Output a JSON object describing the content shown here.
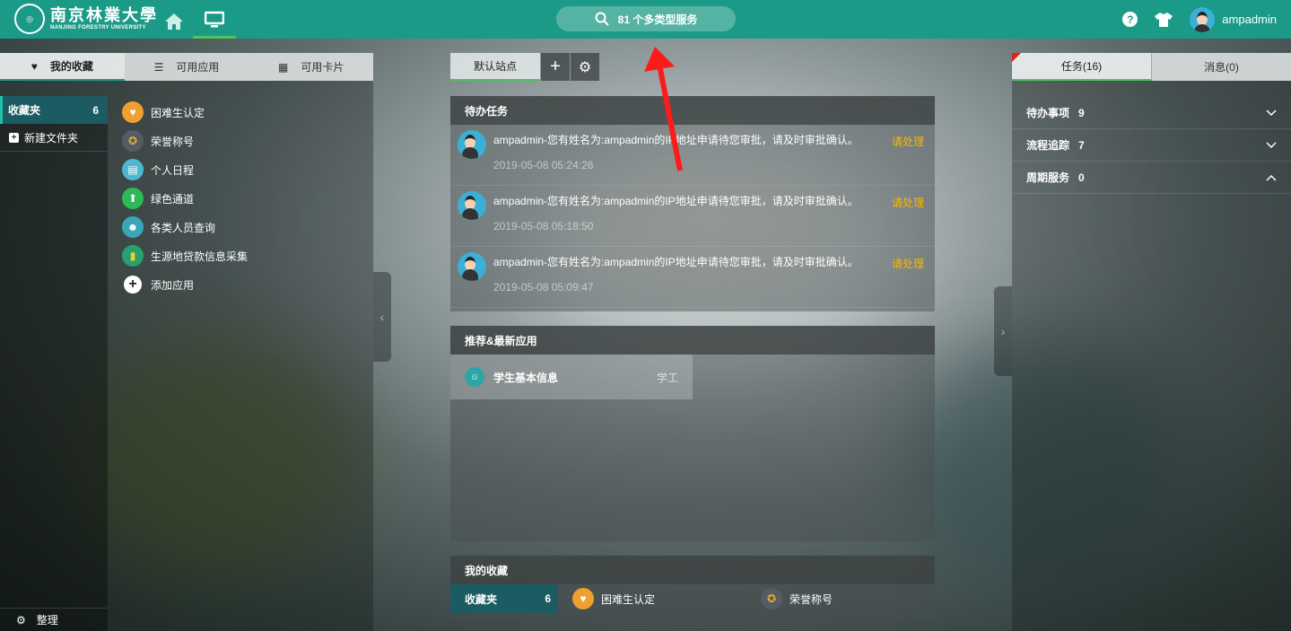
{
  "header": {
    "logo_cn": "南京林業大學",
    "logo_en": "NANJING FORESTRY UNIVERSITY",
    "search_text": "81 个多类型服务",
    "username": "ampadmin",
    "help_glyph": "?"
  },
  "left": {
    "tabs": [
      {
        "label": "我的收藏",
        "icon": "heart-icon"
      },
      {
        "label": "可用应用",
        "icon": "list-icon"
      },
      {
        "label": "可用卡片",
        "icon": "grid-icon"
      }
    ],
    "folder": {
      "label": "收藏夹",
      "count": "6"
    },
    "new_folder": "新建文件夹",
    "footer": "整理",
    "apps": [
      {
        "label": "困难生认定",
        "color": "#f0a030"
      },
      {
        "label": "荣誉称号",
        "color": "#555c66"
      },
      {
        "label": "个人日程",
        "color": "#4fb8d0"
      },
      {
        "label": "绿色通道",
        "color": "#2fb85a"
      },
      {
        "label": "各类人员查询",
        "color": "#3aa6b8"
      },
      {
        "label": "生源地贷款信息采集",
        "color": "#28a070"
      }
    ],
    "add_app": "添加应用"
  },
  "center": {
    "site_tab": "默认站点",
    "todo_title": "待办任务",
    "tasks": [
      {
        "text": "ampadmin-您有姓名为:ampadmin的IP地址申请待您审批，请及时审批确认。",
        "time": "2019-05-08 05:24:26",
        "action": "请处理"
      },
      {
        "text": "ampadmin-您有姓名为:ampadmin的IP地址申请待您审批，请及时审批确认。",
        "time": "2019-05-08 05:18:50",
        "action": "请处理"
      },
      {
        "text": "ampadmin-您有姓名为:ampadmin的IP地址申请待您审批，请及时审批确认。",
        "time": "2019-05-08 05:09:47",
        "action": "请处理"
      }
    ],
    "rec_title": "推荐&最新应用",
    "rec_apps": [
      {
        "label": "学生基本信息",
        "tag": "学工"
      }
    ],
    "fav_title": "我的收藏",
    "fav_folder": {
      "label": "收藏夹",
      "count": "6"
    },
    "fav_apps": [
      {
        "label": "困难生认定"
      },
      {
        "label": "荣誉称号"
      }
    ]
  },
  "right": {
    "tabs": [
      {
        "label": "任务(16)"
      },
      {
        "label": "消息(0)"
      }
    ],
    "items": [
      {
        "label": "待办事项",
        "count": "9",
        "chevron": "down"
      },
      {
        "label": "流程追踪",
        "count": "7",
        "chevron": "down"
      },
      {
        "label": "周期服务",
        "count": "0",
        "chevron": "up"
      }
    ]
  },
  "colors": {
    "header": "#1b9b87",
    "accent_green": "#4fc35d",
    "action": "#f5b800",
    "annotation_arrow": "#ff0000"
  }
}
